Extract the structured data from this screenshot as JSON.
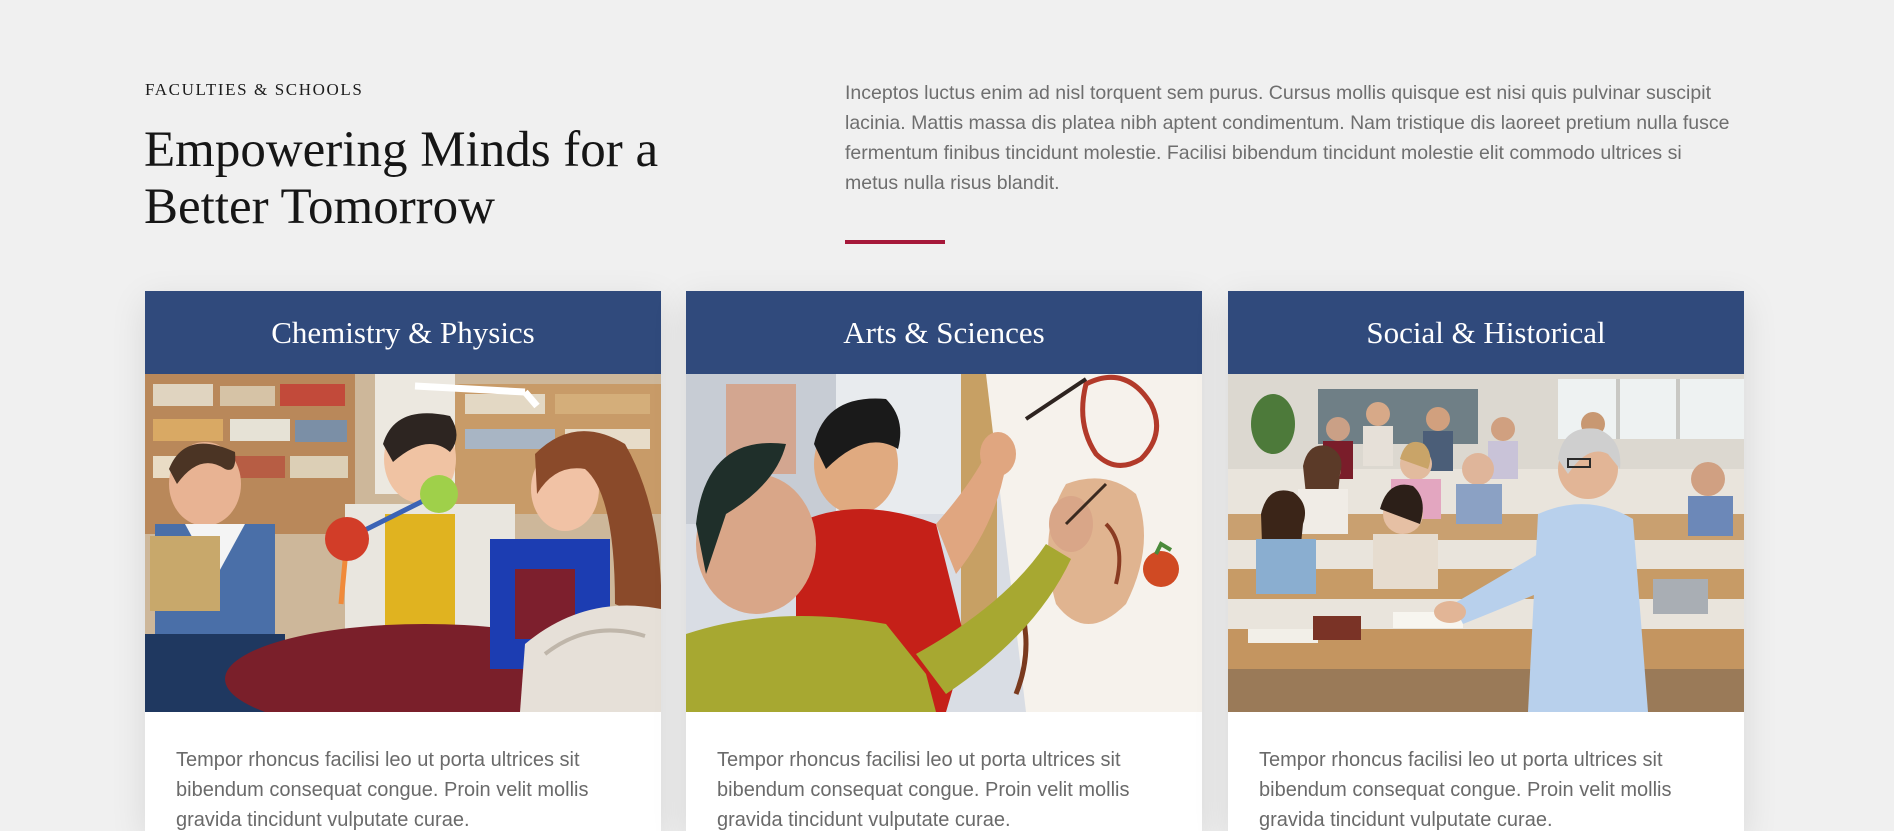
{
  "section": {
    "eyebrow": "FACULTIES & SCHOOLS",
    "title": "Empowering Minds for a Better Tomorrow",
    "intro": "Inceptos luctus enim ad nisl torquent sem purus. Cursus mollis quisque est nisi quis pulvinar suscipit lacinia. Mattis massa dis platea nibh aptent condimentum. Nam tristique dis laoreet pretium nulla fusce fermentum finibus tincidunt molestie. Facilisi bibendum tincidunt molestie elit commodo ultrices si metus nulla risus blandit."
  },
  "cards": [
    {
      "title": "Chemistry & Physics",
      "image": "students-with-molecule-model-photo",
      "text": "Tempor rhoncus facilisi leo ut porta ultrices sit bibendum consequat congue. Proin velit mollis gravida tincidunt vulputate curae."
    },
    {
      "title": "Arts & Sciences",
      "image": "students-painting-canvas-photo",
      "text": "Tempor rhoncus facilisi leo ut porta ultrices sit bibendum consequat congue. Proin velit mollis gravida tincidunt vulputate curae."
    },
    {
      "title": "Social & Historical",
      "image": "lecturer-in-classroom-photo",
      "text": "Tempor rhoncus facilisi leo ut porta ultrices sit bibendum consequat congue. Proin velit mollis gravida tincidunt vulputate curae."
    }
  ],
  "colors": {
    "page_background": "#f0f0f0",
    "card_header": "#304a7c",
    "accent": "#a6183a"
  }
}
